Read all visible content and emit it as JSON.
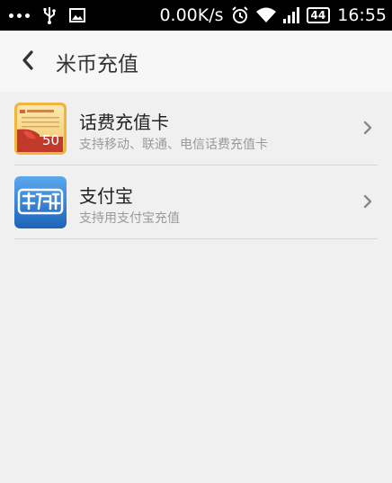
{
  "status_bar": {
    "network_speed": "0.00K/s",
    "battery": "44",
    "time": "16:55",
    "icons": [
      "more-dots-icon",
      "usb-icon",
      "image-icon",
      "alarm-icon",
      "wifi-icon",
      "signal-icon",
      "battery-icon"
    ]
  },
  "header": {
    "title": "米币充值",
    "back_icon": "chevron-left-icon"
  },
  "list": {
    "items": [
      {
        "title": "话费充值卡",
        "subtitle": "支持移动、联通、电信话费充值卡",
        "icon": "phone-card-icon",
        "card_value": "50"
      },
      {
        "title": "支付宝",
        "subtitle": "支持用支付宝充值",
        "icon": "alipay-icon"
      }
    ]
  },
  "colors": {
    "status_bar": "#000000",
    "background": "#f0f0f0",
    "alipay_blue": "#2a7fd4",
    "card_orange": "#f0a020"
  }
}
